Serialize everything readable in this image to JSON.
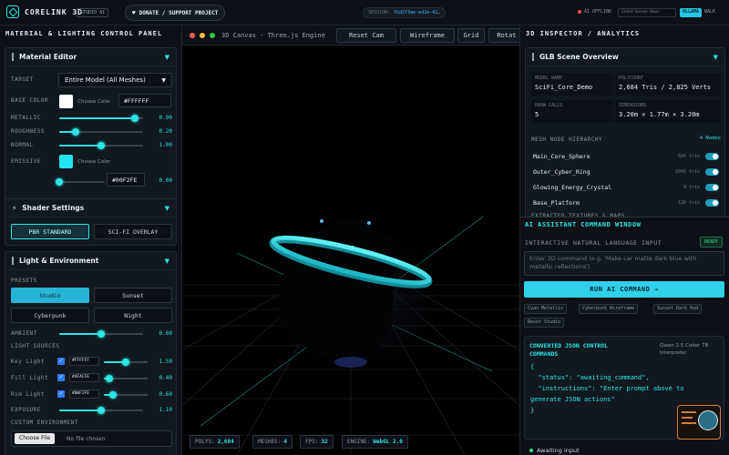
{
  "topbar": {
    "brand": "CORELINK 3D",
    "tag": "STUDIO AI",
    "donate_label": "DONATE / SUPPORT PROJECT",
    "session_key": "SESSION:",
    "session_value": "91d2f3ae-ed2e-42…",
    "ai_status": "AI OFFLINE",
    "api_placeholder": "Client Server Ober",
    "ollama_label": "OLLAMA",
    "walk_label": "WALK"
  },
  "left": {
    "panel_title": "MATERIAL & LIGHTING CONTROL PANEL",
    "material": {
      "header": "Material Editor",
      "target_label": "TARGET",
      "target_value": "Entire Model (All Meshes)",
      "base_color_label": "BASE COLOR",
      "choose_color": "Choose Color",
      "base_hex": "#FFFFFF",
      "base_color": "#ffffff",
      "metallic_label": "METALLIC",
      "metallic_value": "0.90",
      "metallic": 0.9,
      "roughness_label": "ROUGHNESS",
      "roughness_value": "0.20",
      "roughness": 0.2,
      "normal_label": "NORMAL",
      "normal_value": "1.00",
      "normal": 0.5,
      "emissive_label": "EMISSIVE",
      "emissive_color": "#22e3f2",
      "emissive_hex": "#00F2FE",
      "emissive_value": "0.00",
      "emissive": 0.0
    },
    "shader": {
      "header": "Shader Settings",
      "pbr_label": "PBR STANDARD",
      "scifi_label": "SCI-FI OVERLAY"
    },
    "lighting": {
      "header": "Light & Environment",
      "presets_label": "PRESETS",
      "presets": [
        "Studio",
        "Sunset",
        "Cyberpunk",
        "Night"
      ],
      "ambient_label": "AMBIENT",
      "ambient_value": "0.60",
      "ambient": 0.5,
      "sources_label": "LIGHT SOURCES",
      "sources": [
        {
          "name": "Key Light",
          "hex": "#FFFFFF",
          "value": "1.50",
          "level": 0.5
        },
        {
          "name": "Fill Light",
          "hex": "#4FACFE",
          "value": "0.40",
          "level": 0.12
        },
        {
          "name": "Rim Light",
          "hex": "#00F2FE",
          "value": "0.60",
          "level": 0.2
        }
      ],
      "exposure_label": "EXPOSURE",
      "exposure_value": "1.10",
      "exposure": 0.5,
      "custom_env_label": "CUSTOM ENVIRONMENT",
      "choose_file": "Choose File",
      "no_file": "No file chosen"
    }
  },
  "canvas": {
    "title": "3D Canvas - Three.js Engine",
    "buttons": [
      "Reset Cam",
      "Wireframe",
      "Grid",
      "Rotat"
    ],
    "stats": [
      {
        "k": "POLYS:",
        "v": "2,684"
      },
      {
        "k": "MESHES:",
        "v": "4"
      },
      {
        "k": "FPS:",
        "v": "32"
      },
      {
        "k": "ENGINE:",
        "v": "WebGL 2.0"
      }
    ]
  },
  "right": {
    "panel_title": "3D INSPECTOR / ANALYTICS",
    "scene_header": "GLB Scene Overview",
    "model_name_k": "MODEL NAME",
    "model_name_v": "SciFi_Core_Demo",
    "polycount_k": "POLYCOUNT",
    "polycount_v": "2,684 Tris / 2,825 Verts",
    "draw_calls_k": "DRAW CALLS",
    "draw_calls_v": "5",
    "dimensions_k": "DIMENSIONS",
    "dimensions_v": "3.20m × 1.77m × 3.20m",
    "hierarchy_label": "MESH NODE HIERARCHY",
    "nodes_count": "4 Nodes",
    "nodes": [
      {
        "name": "Main_Core_Sphere",
        "tris": "580 tris"
      },
      {
        "name": "Outer_Cyber_Ring",
        "tris": "2048 tris"
      },
      {
        "name": "Glowing_Energy_Crystal",
        "tris": "8 tris"
      },
      {
        "name": "Base_Platform",
        "tris": "128 tris"
      }
    ],
    "textures_label": "EXTRACTED TEXTURES & MAPS"
  },
  "ai": {
    "title": "AI ASSISTANT COMMAND WINDOW",
    "input_label": "INTERACTIVE NATURAL LANGUAGE INPUT",
    "ready": "READY",
    "placeholder": "Enter 3D command (e.g. 'Make car matte dark blue with metallic reflections')",
    "run_label": "RUN AI COMMAND →",
    "chips": [
      "Cyan Metallic",
      "Cyberpunk Wireframe",
      "Sunset Dark Red",
      "Reset Studio"
    ],
    "json_title": "CONVERTED JSON CONTROL COMMANDS",
    "model": "Qwen 2.5 Coder 7B Interpreter",
    "code": "{\n  \"status\": \"awaiting_command\",\n  \"instructions\": \"Enter prompt above to generate JSON actions\"\n}",
    "status": "Awaiting input"
  }
}
